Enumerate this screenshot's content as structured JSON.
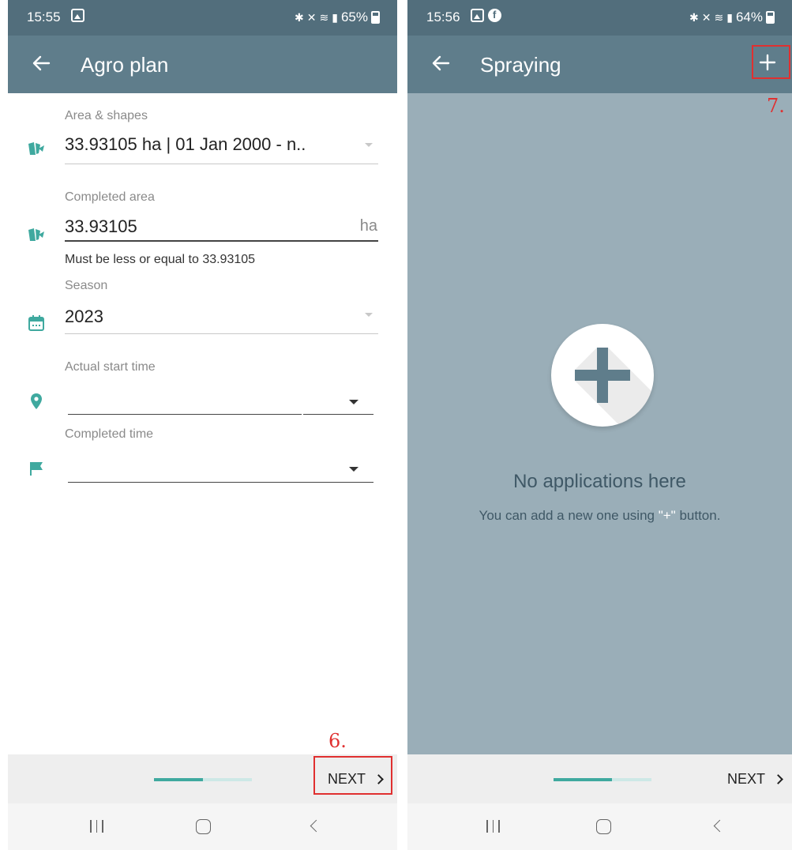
{
  "colors": {
    "status_bar": "#526e7c",
    "app_bar": "#5f7d8b",
    "accent": "#3fa99f",
    "empty_background": "#9aaeb8",
    "annotation": "#e03030"
  },
  "left_screen": {
    "status": {
      "time": "15:55",
      "battery": "65%"
    },
    "app_bar": {
      "title": "Agro plan",
      "back_icon": "arrow-left-icon"
    },
    "fields": {
      "area": {
        "label": "Area & shapes",
        "value": "33.93105 ha | 01 Jan 2000 - n..",
        "icon": "field-shapes-icon"
      },
      "completed_area": {
        "label": "Completed area",
        "value": "33.93105",
        "unit": "ha",
        "helper": "Must be less or equal to 33.93105",
        "icon": "field-shapes-icon"
      },
      "season": {
        "label": "Season",
        "value": "2023",
        "icon": "calendar-icon"
      },
      "start_time": {
        "label": "Actual start time",
        "value": "",
        "icon": "location-pin-icon"
      },
      "completed_time": {
        "label": "Completed time",
        "value": "",
        "icon": "flag-icon"
      }
    },
    "bottom": {
      "next_label": "NEXT",
      "progress": 0.5
    },
    "annotation": "6."
  },
  "right_screen": {
    "status": {
      "time": "15:56",
      "battery": "64%"
    },
    "app_bar": {
      "title": "Spraying",
      "back_icon": "arrow-left-icon",
      "add_icon": "plus-icon"
    },
    "empty_state": {
      "title": "No applications here",
      "subtitle_before": "You can add a new one using ",
      "subtitle_highlight": "\"+\"",
      "subtitle_after": " button."
    },
    "bottom": {
      "next_label": "NEXT",
      "progress": 0.6
    },
    "annotation": "7."
  }
}
